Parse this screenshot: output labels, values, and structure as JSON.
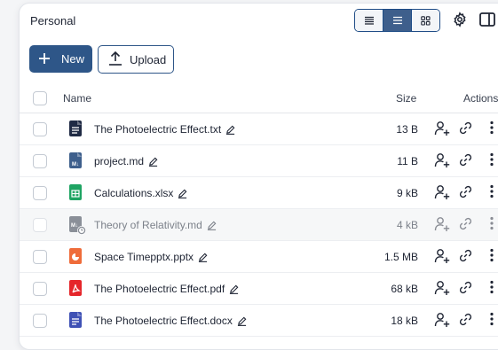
{
  "panel": {
    "title": "Personal"
  },
  "toolbar": {
    "view_modes": [
      "compact-list",
      "list",
      "grid"
    ],
    "active_view": "list",
    "new_label": "New",
    "upload_label": "Upload"
  },
  "table": {
    "headers": {
      "name": "Name",
      "size": "Size",
      "actions": "Actions"
    },
    "rows": [
      {
        "name": "The Photoelectric Effect.txt",
        "size": "13 B",
        "icon": "text-file-icon",
        "color": "#1f2a44",
        "dimmed": false
      },
      {
        "name": "project.md",
        "size": "11 B",
        "icon": "markdown-file-icon",
        "color": "#3e5f8c",
        "dimmed": false
      },
      {
        "name": "Calculations.xlsx",
        "size": "9 kB",
        "icon": "spreadsheet-file-icon",
        "color": "#1fa463",
        "dimmed": false
      },
      {
        "name": "Theory of Relativity.md",
        "size": "4 kB",
        "icon": "markdown-file-syncing-icon",
        "color": "#8a8f98",
        "dimmed": true
      },
      {
        "name": "Space Timepptx.pptx",
        "size": "1.5 MB",
        "icon": "presentation-file-icon",
        "color": "#ef6c3a",
        "dimmed": false
      },
      {
        "name": "The Photoelectric Effect.pdf",
        "size": "68 kB",
        "icon": "pdf-file-icon",
        "color": "#e5252a",
        "dimmed": false
      },
      {
        "name": "The Photoelectric Effect.docx",
        "size": "18 kB",
        "icon": "document-file-icon",
        "color": "#3f51b5",
        "dimmed": false
      }
    ]
  },
  "colors": {
    "primary": "#2e5688",
    "border": "#e2e5ea"
  }
}
